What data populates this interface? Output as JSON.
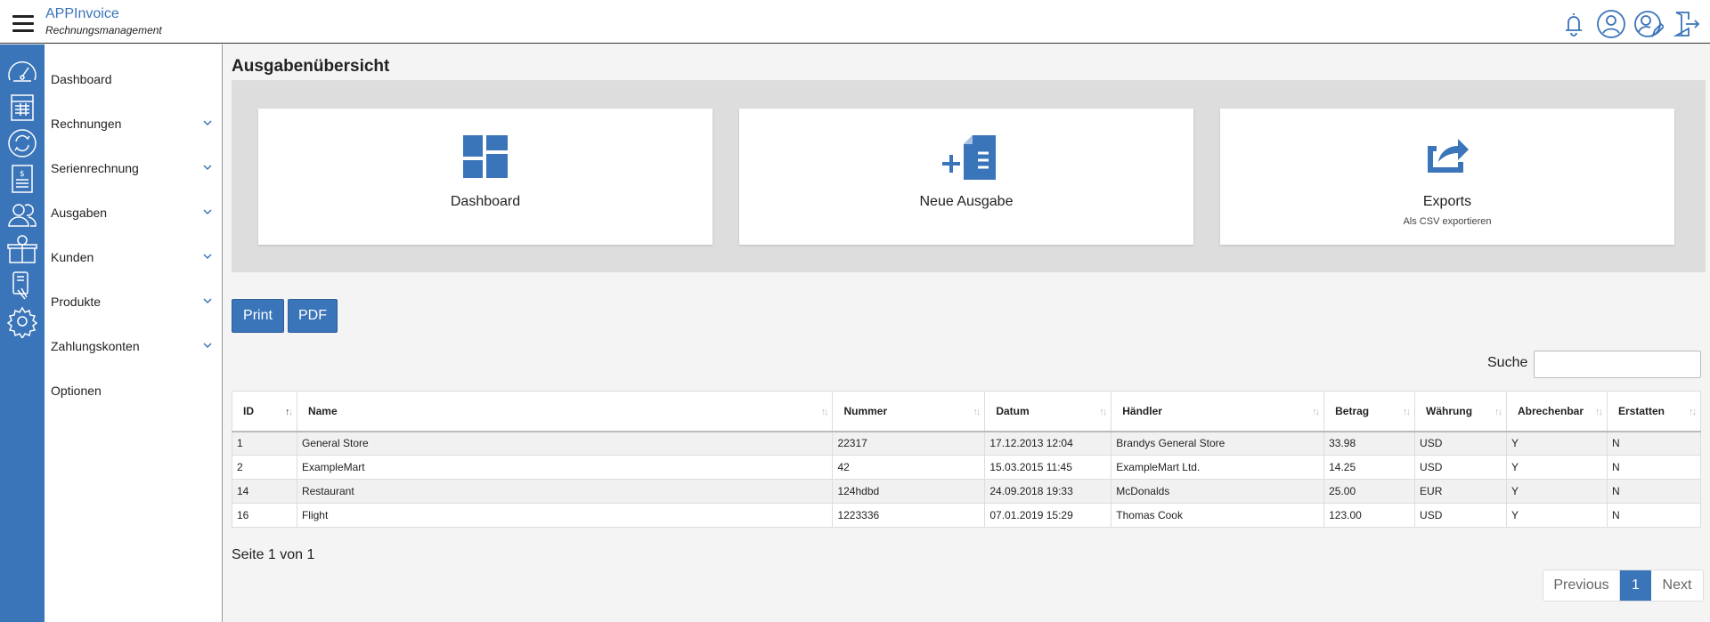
{
  "app": {
    "title": "APPInvoice",
    "subtitle": "Rechnungsmanagement"
  },
  "nav": {
    "items": [
      {
        "label": "Dashboard",
        "icon": "speedometer-icon",
        "expandable": false
      },
      {
        "label": "Rechnungen",
        "icon": "invoice-table-icon",
        "expandable": true
      },
      {
        "label": "Serienrechnung",
        "icon": "recurring-arrows-icon",
        "expandable": true
      },
      {
        "label": "Ausgaben",
        "icon": "expense-receipt-icon",
        "expandable": true
      },
      {
        "label": "Kunden",
        "icon": "customers-icon",
        "expandable": true
      },
      {
        "label": "Produkte",
        "icon": "product-box-icon",
        "expandable": true
      },
      {
        "label": "Zahlungskonten",
        "icon": "payment-card-icon",
        "expandable": true
      },
      {
        "label": "Optionen",
        "icon": "gear-icon",
        "expandable": false
      }
    ]
  },
  "page": {
    "title": "Ausgabenübersicht"
  },
  "tiles": [
    {
      "label": "Dashboard",
      "sub": "",
      "icon": "dashboard-grid-icon"
    },
    {
      "label": "Neue Ausgabe",
      "sub": "",
      "icon": "new-document-icon"
    },
    {
      "label": "Exports",
      "sub": "Als CSV exportieren",
      "icon": "export-share-icon"
    }
  ],
  "actions": {
    "print": "Print",
    "pdf": "PDF"
  },
  "search": {
    "label": "Suche",
    "value": "",
    "placeholder": ""
  },
  "table": {
    "columns": [
      "ID",
      "Name",
      "Nummer",
      "Datum",
      "Händler",
      "Betrag",
      "Währung",
      "Abrechenbar",
      "Erstatten"
    ],
    "rows": [
      [
        "1",
        "General Store",
        "22317",
        "17.12.2013 12:04",
        "Brandys General Store",
        "33.98",
        "USD",
        "Y",
        "N"
      ],
      [
        "2",
        "ExampleMart",
        "42",
        "15.03.2015 11:45",
        "ExampleMart Ltd.",
        "14.25",
        "USD",
        "Y",
        "N"
      ],
      [
        "14",
        "Restaurant",
        "124hdbd",
        "24.09.2018 19:33",
        "McDonalds",
        "25.00",
        "EUR",
        "Y",
        "N"
      ],
      [
        "16",
        "Flight",
        "1223336",
        "07.01.2019 15:29",
        "Thomas Cook",
        "123.00",
        "USD",
        "Y",
        "N"
      ]
    ]
  },
  "pagination": {
    "info": "Seite 1 von 1",
    "previous": "Previous",
    "current": "1",
    "next": "Next"
  },
  "colors": {
    "accent": "#3a74b9",
    "header_bg": "#ffffff",
    "tiles_bg": "#dddddd"
  }
}
